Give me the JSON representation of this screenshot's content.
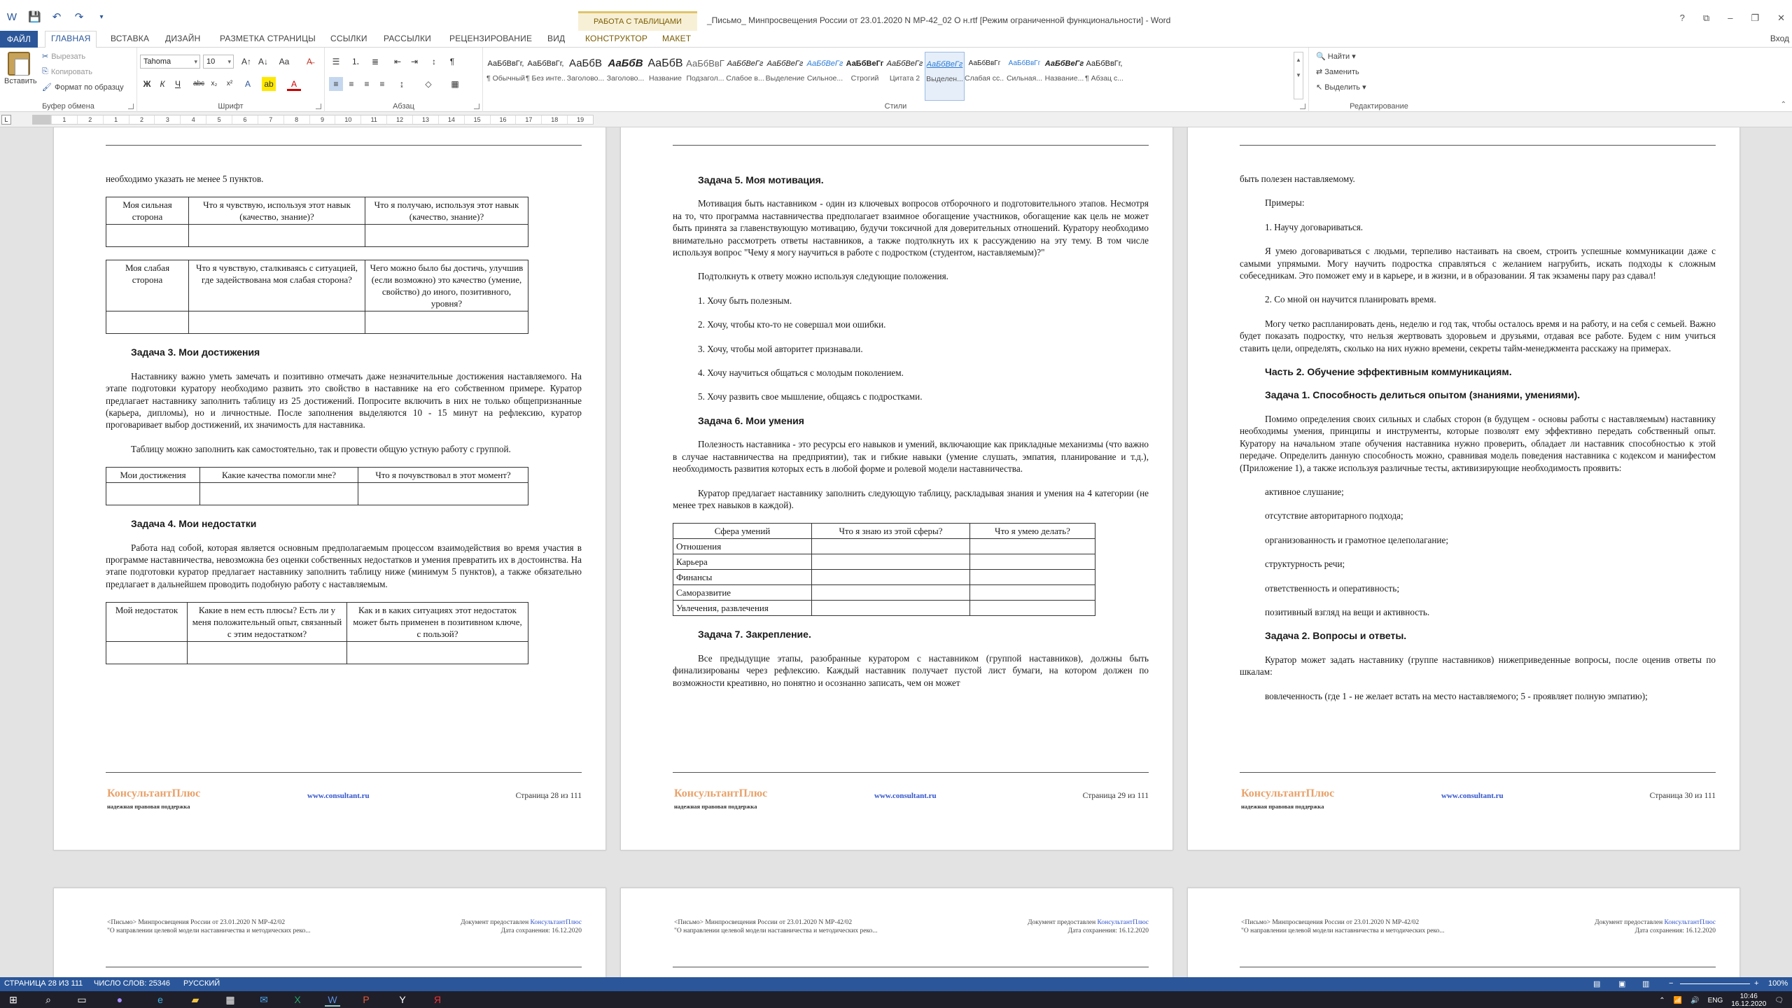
{
  "window": {
    "title": "_Письмо_ Минпросвещения России от 23.01.2020 N МР-42_02  О н.rtf [Режим ограниченной функциональности] - Word",
    "context_group": "РАБОТА С ТАБЛИЦАМИ",
    "controls": [
      "?",
      "⧉",
      "–",
      "❐",
      "✕"
    ],
    "signin": "Вход"
  },
  "tabs": [
    "ФАЙЛ",
    "ГЛАВНАЯ",
    "ВСТАВКА",
    "ДИЗАЙН",
    "РАЗМЕТКА СТРАНИЦЫ",
    "ССЫЛКИ",
    "РАССЫЛКИ",
    "РЕЦЕНЗИРОВАНИЕ",
    "ВИД",
    "КОНСТРУКТОР",
    "МАКЕТ"
  ],
  "ribbon": {
    "clipboard": {
      "paste": "Вставить",
      "cut": "Вырезать",
      "copy": "Копировать",
      "format_painter": "Формат по образцу",
      "label": "Буфер обмена"
    },
    "font": {
      "name": "Tahoma",
      "size": "10",
      "label": "Шрифт"
    },
    "paragraph": {
      "label": "Абзац"
    },
    "styles": {
      "label": "Стили",
      "items": [
        {
          "preview": "АаБбВвГг,",
          "name": "¶ Обычный"
        },
        {
          "preview": "АаБбВвГг,",
          "name": "¶ Без инте..."
        },
        {
          "preview": "АаБбВ",
          "name": "Заголово..."
        },
        {
          "preview": "АаБбВ",
          "name": "Заголово..."
        },
        {
          "preview": "АаБбВ",
          "name": "Название"
        },
        {
          "preview": "АаБбВвГ",
          "name": "Подзагол..."
        },
        {
          "preview": "АаБбВеГг",
          "name": "Слабое в..."
        },
        {
          "preview": "АаБбВеГг",
          "name": "Выделение"
        },
        {
          "preview": "АаБбВеГг",
          "name": "Сильное..."
        },
        {
          "preview": "АаБбВеГг",
          "name": "Строгий"
        },
        {
          "preview": "АаБбВеГг",
          "name": "Цитата 2"
        },
        {
          "preview": "АаБбВеГг",
          "name": "Выделен..."
        },
        {
          "preview": "АаБбВвГг",
          "name": "Слабая сс..."
        },
        {
          "preview": "АаБбВвГг",
          "name": "Сильная..."
        },
        {
          "preview": "АаБбВеГг",
          "name": "Название..."
        },
        {
          "preview": "АаБбВвГг,",
          "name": "¶ Абзац с..."
        }
      ]
    },
    "editing": {
      "find": "Найти",
      "replace": "Заменить",
      "select": "Выделить",
      "label": "Редактирование"
    }
  },
  "ruler": [
    "1",
    "2",
    "1",
    "2",
    "3",
    "4",
    "5",
    "6",
    "7",
    "8",
    "9",
    "10",
    "11",
    "12",
    "13",
    "14",
    "15",
    "16",
    "17",
    "18",
    "19"
  ],
  "header": {
    "left_line1": "<Письмо> Минпросвещения России от 23.01.2020 N МР-42/02",
    "left_line2": "\"О направлении целевой модели наставничества и методических реко...",
    "right_line1": "Документ предоставлен",
    "right_link": "КонсультантПлюс",
    "right_line2": "Дата сохранения: 16.12.2020"
  },
  "footer": {
    "logo": "КонсультантПлюс",
    "tagline": "надежная правовая поддержка",
    "url": "www.consultant.ru"
  },
  "pages": {
    "p28": {
      "page_label": "Страница 28 из 111",
      "intro": "необходимо указать не менее 5 пунктов.",
      "table1": [
        "Моя сильная сторона",
        "Что я чувствую, используя этот навык (качество, знание)?",
        "Что я получаю, используя этот навык (качество, знание)?"
      ],
      "table2": [
        "Моя слабая сторона",
        "Что я чувствую, сталкиваясь с ситуацией, где задействована моя слабая сторона?",
        "Чего можно было бы достичь, улучшив (если возможно) это качество (умение, свойство) до иного, позитивного, уровня?"
      ],
      "h3": "Задача 3. Мои достижения",
      "p3a": "Наставнику важно уметь замечать и позитивно отмечать даже незначительные достижения наставляемого. На этапе подготовки куратору необходимо развить это свойство в наставнике на его собственном примере. Куратор предлагает наставнику заполнить таблицу из 25 достижений. Попросите включить в них не только общепризнанные (карьера, дипломы), но и личностные. После заполнения выделяются 10 - 15 минут на рефлексию, куратор проговаривает выбор достижений, их значимость для наставника.",
      "p3b": "Таблицу можно заполнить как самостоятельно, так и провести общую устную работу с группой.",
      "table3": [
        "Мои достижения",
        "Какие качества помогли мне?",
        "Что я почувствовал в этот момент?"
      ],
      "h4": "Задача 4. Мои недостатки",
      "p4": "Работа над собой, которая является основным предполагаемым процессом взаимодействия во время участия в программе наставничества, невозможна без оценки собственных недостатков и умения превратить их в достоинства. На этапе подготовки куратор предлагает наставнику заполнить таблицу ниже (минимум 5 пунктов), а также обязательно предлагает в дальнейшем проводить подобную работу с наставляемым.",
      "table4": [
        "Мой недостаток",
        "Какие в нем есть плюсы? Есть ли у меня положительный опыт, связанный с этим недостатком?",
        "Как и в каких ситуациях этот недостаток может быть применен в позитивном ключе, с пользой?"
      ]
    },
    "p29": {
      "page_label": "Страница 29 из 111",
      "h5": "Задача 5. Моя мотивация.",
      "p5a": "Мотивация быть наставником - один из ключевых вопросов отборочного и подготовительного этапов. Несмотря на то, что программа наставничества предполагает взаимное обогащение участников, обогащение как цель не может быть принята за главенствующую мотивацию, будучи токсичной для доверительных отношений. Куратору необходимо внимательно рассмотреть ответы наставников, а также подтолкнуть их к рассуждению на эту тему. В том числе используя вопрос \"Чему я могу научиться в работе с подростком (студентом, наставляемым)?\"",
      "p5b": "Подтолкнуть к ответу можно используя следующие положения.",
      "list5": [
        "1. Хочу быть полезным.",
        "2. Хочу, чтобы кто-то не совершал мои ошибки.",
        "3. Хочу, чтобы мой авторитет признавали.",
        "4. Хочу научиться общаться с молодым поколением.",
        "5. Хочу развить свое мышление, общаясь с подростками."
      ],
      "h6": "Задача 6. Мои умения",
      "p6a": "Полезность наставника - это ресурсы его навыков и умений, включающие как прикладные механизмы (что важно в случае наставничества на предприятии), так и гибкие навыки (умение слушать, эмпатия, планирование и т.д.), необходимость развития которых есть в любой форме и ролевой модели наставничества.",
      "p6b": "Куратор предлагает наставнику заполнить следующую таблицу, раскладывая знания и умения на 4 категории (не менее трех навыков в каждой).",
      "table6_head": [
        "Сфера умений",
        "Что я знаю из этой сферы?",
        "Что я умею делать?"
      ],
      "table6_rows": [
        "Отношения",
        "Карьера",
        "Финансы",
        "Саморазвитие",
        "Увлечения, развлечения"
      ],
      "h7": "Задача 7. Закрепление.",
      "p7": "Все предыдущие этапы, разобранные куратором с наставником (группой наставников), должны быть финализированы через рефлексию. Каждый наставник получает пустой лист бумаги, на котором должен по возможности креативно, но понятно и осознанно записать, чем он может"
    },
    "p30": {
      "page_label": "Страница 30 из 111",
      "intro": "быть полезен наставляемому.",
      "examples": "Примеры:",
      "ex1": "1. Научу договариваться.",
      "ex1_text": "Я умею договариваться с людьми, терпеливо настаивать на своем, строить успешные коммуникации даже с самыми упрямыми. Могу научить подростка справляться с желанием нагрубить, искать подходы к сложным собеседникам. Это поможет ему и в карьере, и в жизни, и в образовании. Я так экзамены пару раз сдавал!",
      "ex2": "2. Со мной он научится планировать время.",
      "ex2_text": "Могу четко распланировать день, неделю и год так, чтобы осталось время и на работу, и на себя с семьей. Важно будет показать подростку, что нельзя жертвовать здоровьем и друзьями, отдавая все работе. Будем с ним учиться ставить цели, определять, сколько на них нужно времени, секреты тайм-менеджмента расскажу на примерах.",
      "part2": "Часть 2. Обучение эффективным коммуникациям.",
      "h1": "Задача 1. Способность делиться опытом (знаниями, умениями).",
      "p1": "Помимо определения своих сильных и слабых сторон (в будущем - основы работы с наставляемым) наставнику необходимы умения, принципы и инструменты, которые позволят ему эффективно передать собственный опыт. Куратору на начальном этапе обучения наставника нужно проверить, обладает ли наставник способностью к этой передаче. Определить данную способность можно, сравнивая модель поведения наставника с кодексом и манифестом (Приложение 1), а также используя различные тесты, активизирующие необходимость проявить:",
      "list1": [
        "активное слушание;",
        "отсутствие авторитарного подхода;",
        "организованность и грамотное целеполагание;",
        "структурность речи;",
        "ответственность и оперативность;",
        "позитивный взгляд на вещи и активность."
      ],
      "h2": "Задача 2. Вопросы и ответы.",
      "p2": "Куратор может задать наставнику (группе наставников) нижеприведенные вопросы, после оценив ответы по шкалам:",
      "p2b": "вовлеченность (где 1 - не желает встать на место наставляемого; 5 - проявляет полную эмпатию);"
    }
  },
  "status": {
    "page": "СТРАНИЦА 28 ИЗ 111",
    "words": "ЧИСЛО СЛОВ: 25346",
    "lang": "РУССКИЙ",
    "zoom": "100%"
  },
  "tray": {
    "lang": "ENG",
    "time": "10:46",
    "date": "16.12.2020"
  }
}
